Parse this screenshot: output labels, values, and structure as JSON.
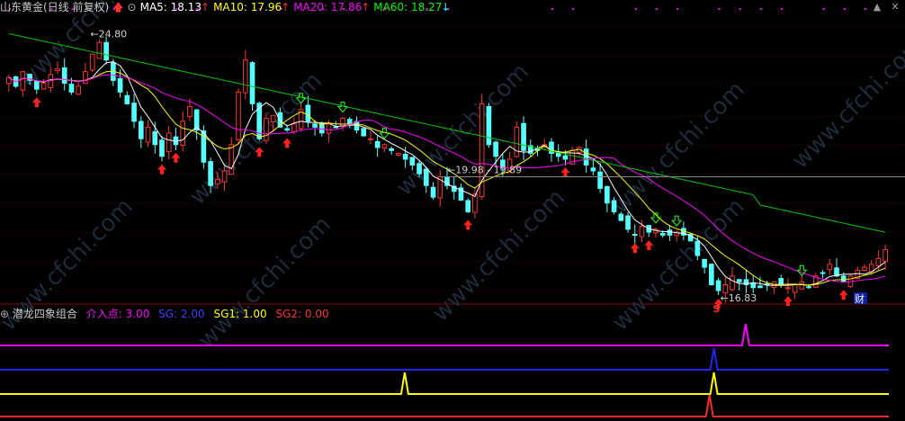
{
  "header": {
    "title": "山东黄金(日线 前复权)",
    "ma": [
      {
        "label": "MA5: 18.13",
        "arrow": "↑",
        "color": "#ffffff"
      },
      {
        "label": "MA10: 17.96",
        "arrow": "↑",
        "color": "#ffff00"
      },
      {
        "label": "MA20: 17.86",
        "arrow": "↑",
        "color": "#ff00ff"
      },
      {
        "label": "MA60: 18.27",
        "arrow": "↓",
        "color": "#00ff00"
      }
    ]
  },
  "watermark": "www.cfchi.com",
  "chart_data": [
    {
      "type": "candlestick",
      "title": "山东黄金(日线 前复权)",
      "annotations": [
        {
          "text": "24.80",
          "kind": "high"
        },
        {
          "text": "19.98 - 19.89",
          "kind": "level",
          "value": 19.9
        },
        {
          "text": "16.83",
          "kind": "low"
        },
        {
          "text": "S",
          "kind": "marker"
        },
        {
          "text": "财",
          "kind": "badge"
        }
      ],
      "close": [
        23.3,
        23.0,
        23.5,
        23.2,
        22.9,
        23.1,
        23.4,
        23.6,
        23.1,
        22.8,
        23.0,
        23.5,
        24.1,
        24.5,
        23.9,
        23.2,
        22.8,
        22.4,
        21.8,
        21.2,
        21.6,
        21.0,
        20.6,
        21.4,
        21.0,
        21.8,
        22.3,
        21.5,
        20.4,
        19.6,
        19.8,
        20.1,
        21.0,
        22.8,
        23.9,
        22.4,
        21.2,
        21.9,
        22.0,
        21.6,
        21.5,
        21.7,
        22.2,
        21.8,
        21.6,
        21.4,
        21.7,
        21.6,
        21.9,
        21.7,
        21.5,
        21.3,
        21.2,
        20.9,
        21.0,
        20.8,
        20.7,
        20.5,
        20.3,
        20.0,
        19.6,
        19.2,
        19.9,
        19.6,
        19.4,
        19.1,
        18.7,
        19.3,
        22.4,
        21.0,
        20.6,
        20.2,
        20.5,
        21.6,
        20.8,
        20.7,
        20.8,
        21.0,
        20.7,
        20.6,
        20.5,
        20.8,
        20.9,
        20.3,
        20.1,
        19.5,
        19.0,
        18.7,
        18.4,
        18.1,
        17.9,
        18.2,
        18.0,
        18.1,
        17.9,
        17.9,
        18.0,
        17.9,
        17.7,
        17.2,
        16.8,
        16.2,
        16.0,
        16.2,
        16.5,
        16.3,
        16.2,
        16.1,
        16.1,
        16.2,
        16.3,
        16.2,
        16.1,
        16.2,
        16.3,
        16.1,
        16.5,
        16.6,
        16.9,
        16.5,
        16.3,
        16.5,
        16.7,
        16.8,
        16.9,
        17.1,
        17.4
      ]
    },
    {
      "type": "line",
      "title": "潜龙四象组合",
      "series": [
        {
          "name": "介入点",
          "value_label": "3.00",
          "color": "#ff00ff",
          "spike_at": 0.838
        },
        {
          "name": "SG",
          "value_label": "2.00",
          "color": "#2222ff",
          "spike_at": 0.802
        },
        {
          "name": "SG1",
          "value_label": "1.00",
          "color": "#ffff00",
          "spike_at": [
            0.452,
            0.802
          ]
        },
        {
          "name": "SG2",
          "value_label": "0.00",
          "color": "#ff2a2a",
          "spike_at": 0.797
        }
      ]
    }
  ]
}
